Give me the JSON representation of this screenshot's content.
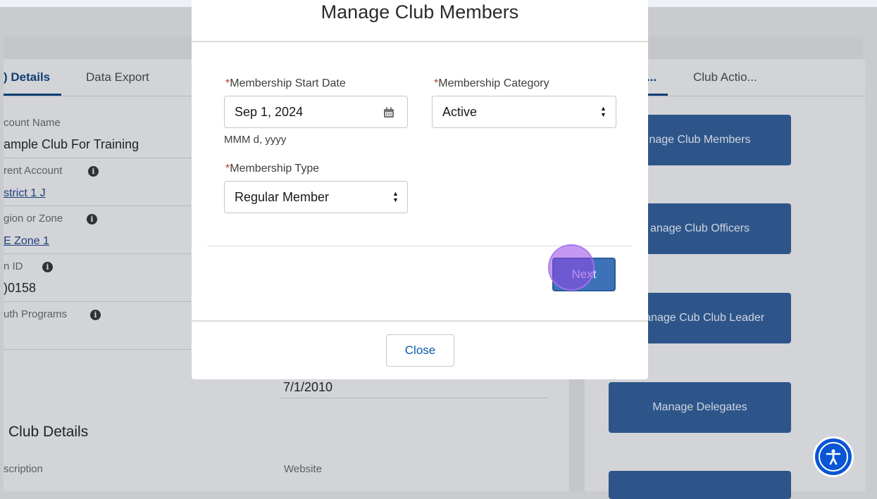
{
  "modal": {
    "title": "Manage Club Members",
    "required_mark": "*",
    "start_date": {
      "label": "Membership Start Date",
      "value": "Sep 1, 2024",
      "hint": "MMM d, yyyy"
    },
    "category": {
      "label": "Membership Category",
      "value": "Active"
    },
    "type": {
      "label": "Membership Type",
      "value": "Regular Member"
    },
    "next_label": "Next",
    "close_label": "Close"
  },
  "tabs": {
    "left": [
      "Details",
      "Data Export"
    ],
    "right": [
      "...",
      "Club Actio..."
    ]
  },
  "fields": [
    {
      "label": "count Name",
      "value": "ample Club For Training",
      "info": false,
      "link": false
    },
    {
      "label": "rent Account",
      "value": "strict 1 J",
      "info": true,
      "link": true
    },
    {
      "label": "gion or Zone",
      "value": "Zone 1",
      "info": true,
      "link": true
    },
    {
      "label": "n ID",
      "value": ")0158",
      "info": true,
      "link": false
    },
    {
      "label": "uth Programs",
      "value": "",
      "info": true,
      "link": false
    }
  ],
  "chartered_date": "7/1/2010",
  "section_title": "Club Details",
  "bottom_labels": {
    "description": "scription",
    "website": "Website"
  },
  "side_buttons": {
    "members": "nage Club Members",
    "officers": "anage Club Officers",
    "cub_leader": "Manage Cub Club Leader",
    "delegates": "Manage Delegates"
  },
  "icons": {
    "calendar": "calendar-icon",
    "select": "select-arrows-icon",
    "info": "info-icon",
    "accessibility": "accessibility-icon"
  },
  "colors": {
    "brand_button": "#2e5589",
    "next_button": "#3d72b9",
    "required": "#c23934",
    "accessibility": "#0a55d6",
    "click_indicator": "#9646e6"
  }
}
